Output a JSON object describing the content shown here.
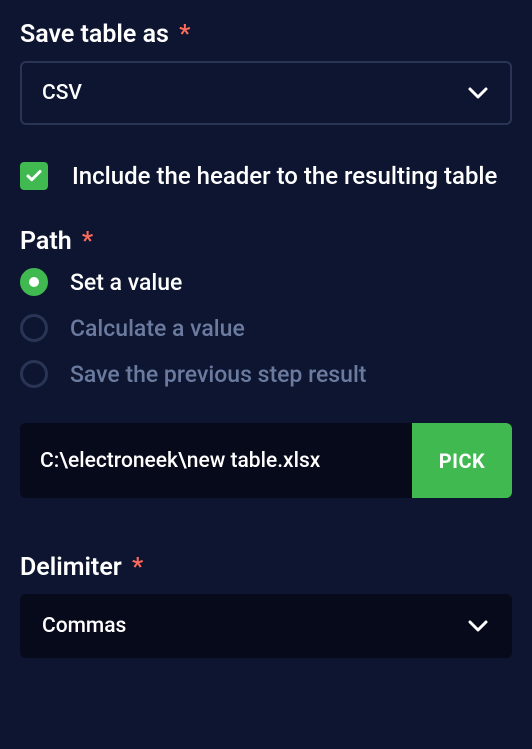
{
  "saveTableAs": {
    "label": "Save table as",
    "required": "*",
    "value": "CSV"
  },
  "includeHeader": {
    "label": "Include the header to the resulting table",
    "checked": true
  },
  "path": {
    "label": "Path",
    "required": "*",
    "options": {
      "setValue": "Set a value",
      "calculateValue": "Calculate a value",
      "savePrevious": "Save the previous step result"
    },
    "value": "C:\\electroneek\\new table.xlsx",
    "pickButton": "PICK"
  },
  "delimiter": {
    "label": "Delimiter",
    "required": "*",
    "value": "Commas"
  }
}
